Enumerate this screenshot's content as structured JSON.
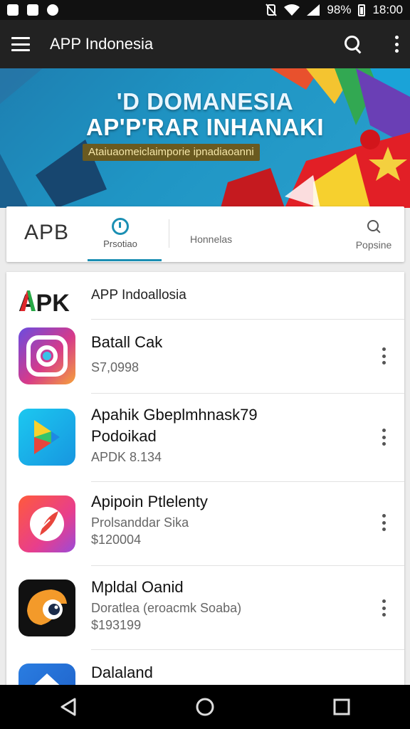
{
  "status_bar": {
    "battery": "98%",
    "time": "18:00"
  },
  "app_bar": {
    "title": "APP Indonesia"
  },
  "banner": {
    "line1": "'D DOMANESIA",
    "line2": "AP'P'RAR INHANAKI",
    "tagline": "Ataiuaomeiclaimporie ipnadiaoanni"
  },
  "tabs": {
    "brand": "APB",
    "tab_a": "Prsotiao",
    "tab_b": "Honnelas",
    "tab_c": "Popsine"
  },
  "list": {
    "header_title": "APP Indoallosia",
    "apk_logo_text": "APK",
    "items": [
      {
        "title": "Batall Cak",
        "subtitle": "",
        "price": "S7,0998",
        "icon": "camera-app-icon"
      },
      {
        "title": "Apahik Gbeplmhnask79",
        "subtitle": "Podoikad",
        "price": "APDK 8.134",
        "icon": "play-store-icon"
      },
      {
        "title": "Apipoin Ptlelenty",
        "subtitle": "Prolsanddar Sika",
        "price": "$120004",
        "icon": "feather-app-icon"
      },
      {
        "title": "Mpldal Oanid",
        "subtitle": "Doratlea (eroacmk Soaba)",
        "price": "$193199",
        "icon": "bird-app-icon"
      },
      {
        "title": "Dalaland",
        "subtitle": "",
        "price": "",
        "icon": "home-app-icon"
      }
    ]
  },
  "colors": {
    "accent": "#1b8fb3",
    "app_bar": "#222222",
    "banner_blue": "#1f95c4"
  }
}
